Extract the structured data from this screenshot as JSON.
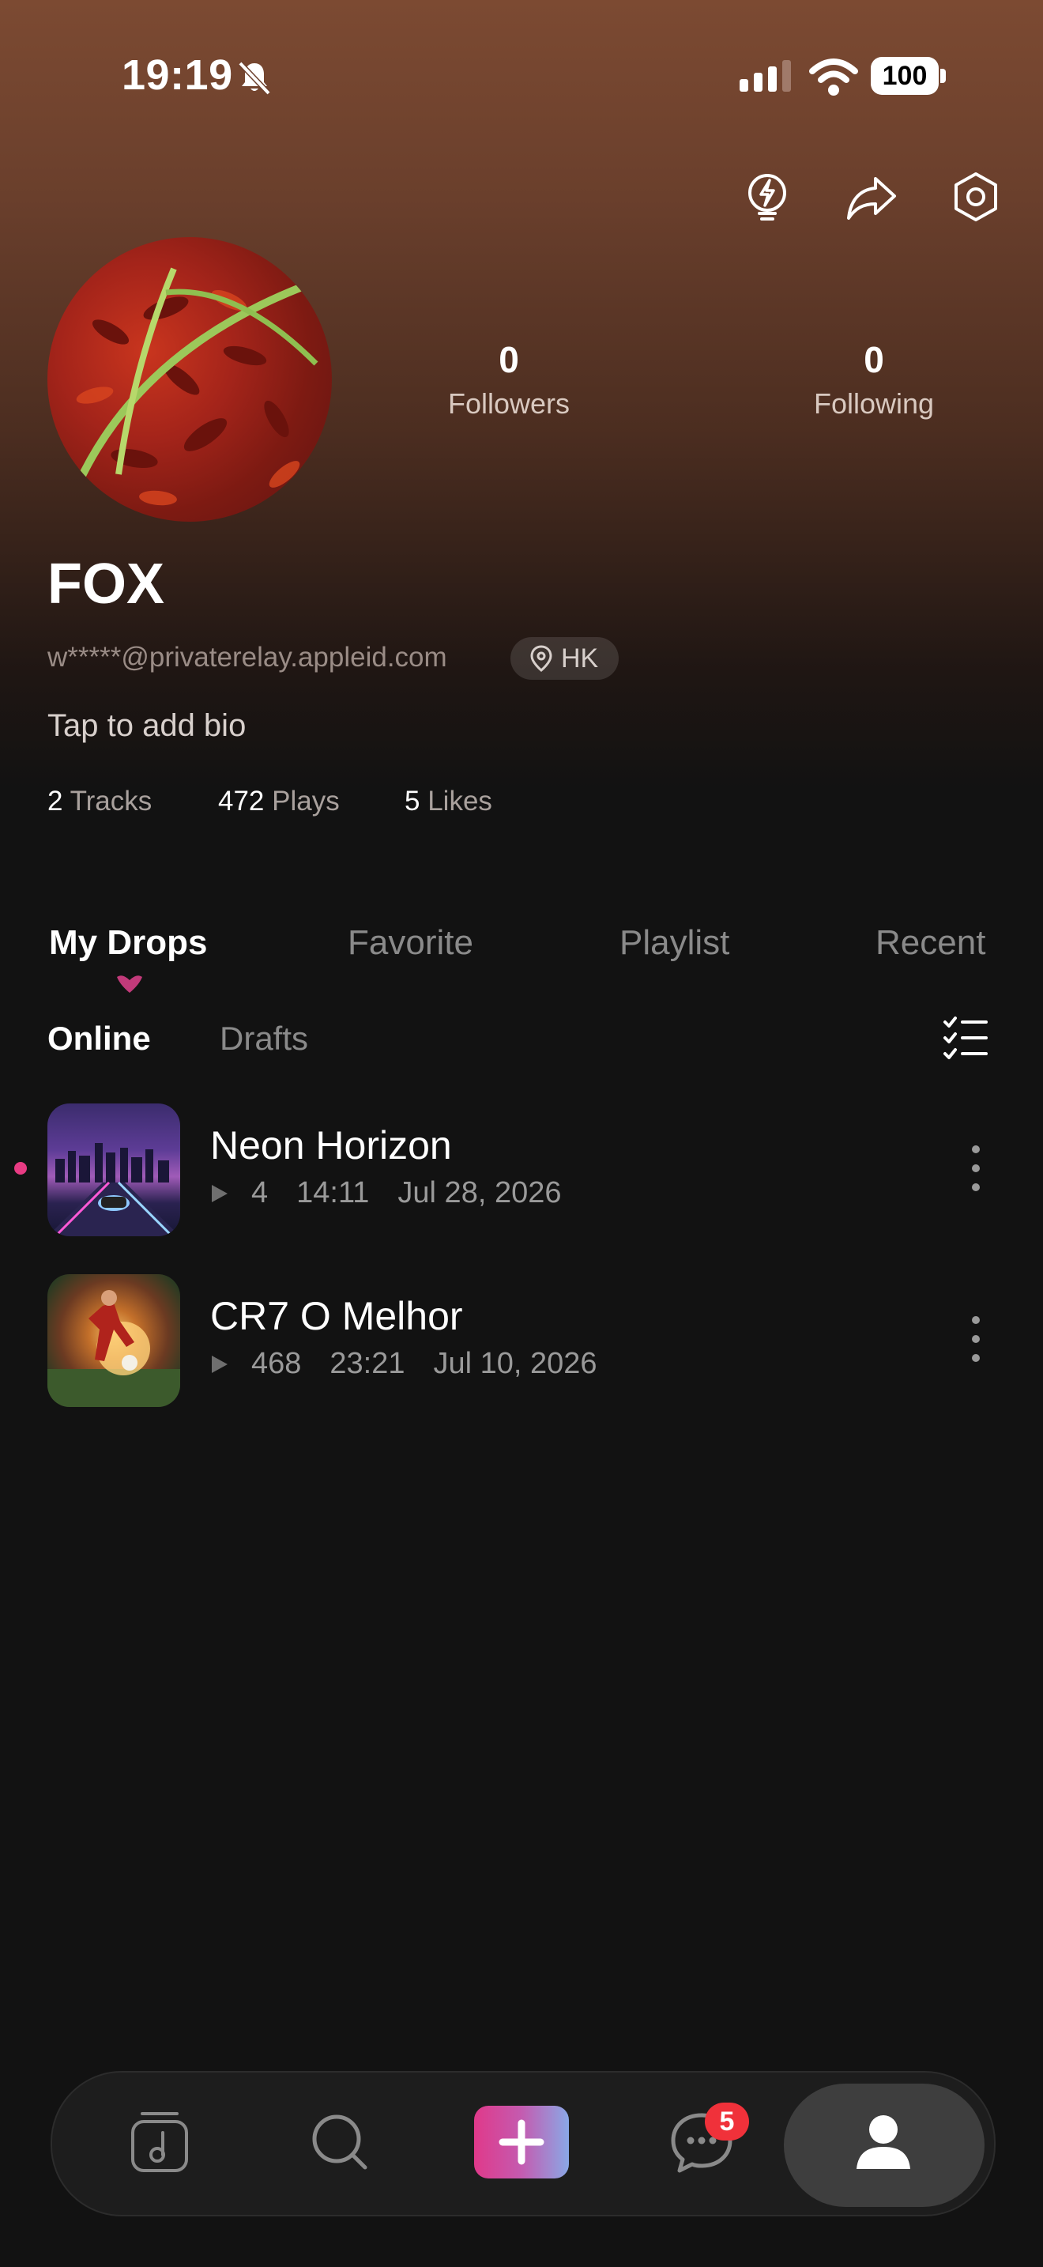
{
  "status_bar": {
    "time": "19:19",
    "battery": "100"
  },
  "profile": {
    "followers_count": "0",
    "followers_label": "Followers",
    "following_count": "0",
    "following_label": "Following",
    "name": "FOX",
    "email": "w*****@privaterelay.appleid.com",
    "region": "HK",
    "bio_placeholder": "Tap to add bio",
    "tracks_count": "2",
    "tracks_label": "Tracks",
    "plays_count": "472",
    "plays_label": "Plays",
    "likes_count": "5",
    "likes_label": "Likes"
  },
  "tabs": [
    "My Drops",
    "Favorite",
    "Playlist",
    "Recent"
  ],
  "subtabs": [
    "Online",
    "Drafts"
  ],
  "tracks": [
    {
      "title": "Neon Horizon",
      "plays": "4",
      "duration": "14:11",
      "date": "Jul 28, 2026"
    },
    {
      "title": "CR7 O Melhor",
      "plays": "468",
      "duration": "23:21",
      "date": "Jul 10, 2026"
    }
  ],
  "nav": {
    "messages_badge": "5"
  },
  "colors": {
    "accent_pink": "#e83b83",
    "badge_red": "#f0313a"
  }
}
